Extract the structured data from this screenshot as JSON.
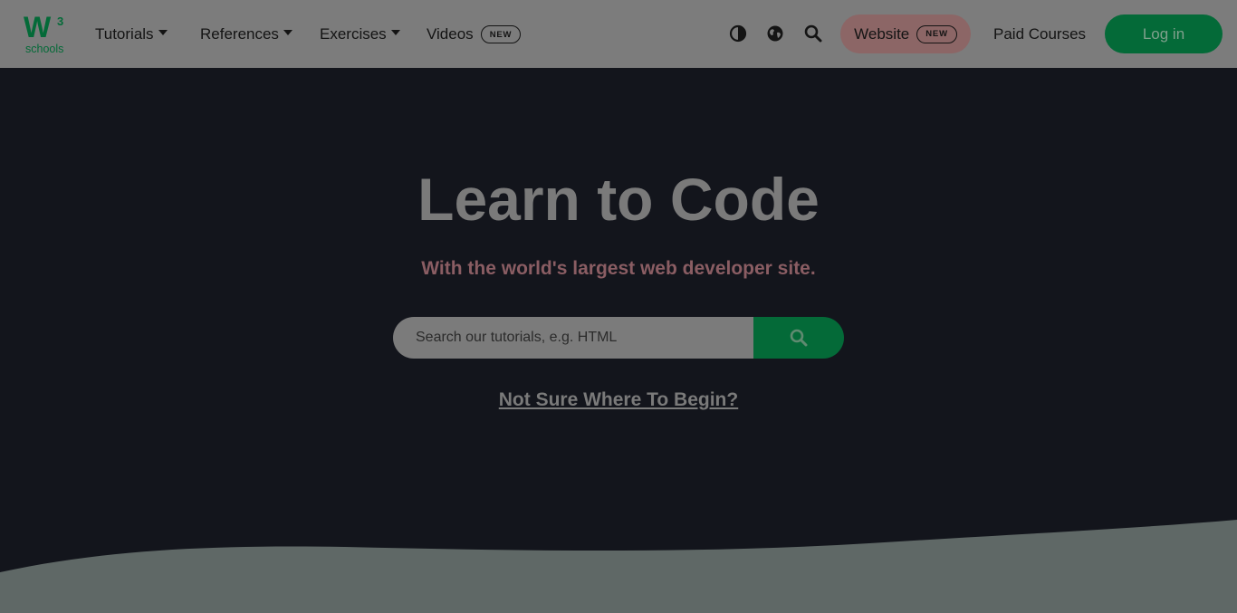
{
  "brand": {
    "logo_mark": "W",
    "logo_superscript": "3",
    "logo_text": "schools"
  },
  "nav": {
    "items": [
      {
        "label": "Tutorials",
        "dropdown": true
      },
      {
        "label": "References",
        "dropdown": true
      },
      {
        "label": "Exercises",
        "dropdown": true
      }
    ],
    "videos": {
      "label": "Videos",
      "badge": "NEW"
    },
    "icons": [
      "contrast-icon",
      "globe-icon",
      "search-icon"
    ],
    "website": {
      "label": "Website",
      "badge": "NEW"
    },
    "paid_courses": "Paid Courses",
    "login": "Log in"
  },
  "hero": {
    "title": "Learn to Code",
    "subtitle": "With the world's largest web developer site.",
    "search_placeholder": "Search our tutorials, e.g. HTML",
    "begin_link": "Not Sure Where To Begin?"
  },
  "colors": {
    "brand_green": "#046a38",
    "hero_background": "#13151c",
    "website_pill": "#8c6666",
    "subtitle": "#8a5d63"
  }
}
